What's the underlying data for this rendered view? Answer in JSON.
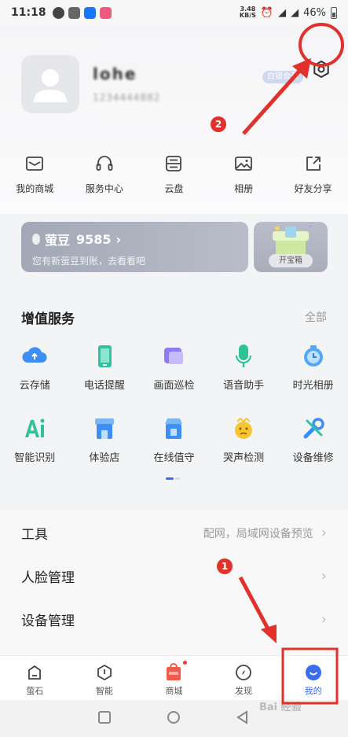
{
  "status_bar": {
    "time": "11:18",
    "net_speed_value": "3.48",
    "net_speed_unit": "KB/S",
    "battery": "46%"
  },
  "profile": {
    "name": "lohe",
    "phone": "1234444882",
    "member_badge": "白银会员"
  },
  "annotations": {
    "step1": "1",
    "step2": "2"
  },
  "quick_actions": [
    {
      "label": "我的商城",
      "icon": "mail-icon"
    },
    {
      "label": "服务中心",
      "icon": "headset-icon"
    },
    {
      "label": "云盘",
      "icon": "cloud-disk-icon"
    },
    {
      "label": "相册",
      "icon": "photo-icon"
    },
    {
      "label": "好友分享",
      "icon": "share-icon"
    }
  ],
  "coins": {
    "title": "萤豆",
    "amount": "9585",
    "subtitle": "您有新萤豆到账，去看看吧"
  },
  "treasure": {
    "button": "开宝箱"
  },
  "value_added": {
    "title": "增值服务",
    "all": "全部",
    "items": [
      {
        "label": "云存储",
        "icon": "cloud-storage-icon"
      },
      {
        "label": "电话提醒",
        "icon": "phone-reminder-icon"
      },
      {
        "label": "画面巡检",
        "icon": "screen-inspection-icon"
      },
      {
        "label": "语音助手",
        "icon": "voice-assistant-icon"
      },
      {
        "label": "时光相册",
        "icon": "time-album-icon"
      },
      {
        "label": "智能识别",
        "icon": "ai-recognition-icon"
      },
      {
        "label": "体验店",
        "icon": "experience-store-icon"
      },
      {
        "label": "在线值守",
        "icon": "online-duty-icon"
      },
      {
        "label": "哭声检测",
        "icon": "cry-detection-icon"
      },
      {
        "label": "设备维修",
        "icon": "device-repair-icon"
      }
    ]
  },
  "menu": {
    "tools_label": "工具",
    "tools_sub": "配网，局域网设备预览",
    "face_label": "人脸管理",
    "device_label": "设备管理"
  },
  "tabs": [
    {
      "label": "萤石",
      "icon": "home-icon"
    },
    {
      "label": "智能",
      "icon": "smart-icon"
    },
    {
      "label": "商城",
      "icon": "mall-icon"
    },
    {
      "label": "发现",
      "icon": "compass-icon"
    },
    {
      "label": "我的",
      "icon": "profile-icon",
      "active": true
    }
  ],
  "colors": {
    "accent": "#3b6cf0",
    "annotation_red": "#e0322b"
  },
  "watermark": "Bai 经验"
}
